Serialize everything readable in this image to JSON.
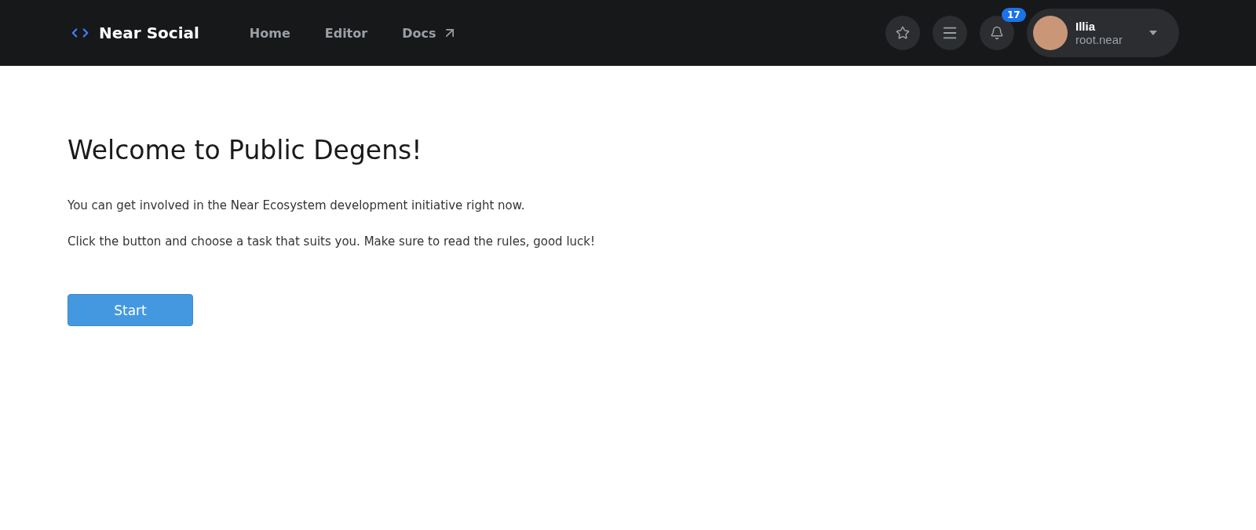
{
  "header": {
    "brand": "Near Social",
    "nav": [
      {
        "label": "Home",
        "kind": "internal"
      },
      {
        "label": "Editor",
        "kind": "internal"
      },
      {
        "label": "Docs",
        "kind": "external"
      }
    ],
    "notifications": {
      "count": "17"
    },
    "user": {
      "name": "Illia",
      "account": "root.near"
    }
  },
  "main": {
    "title": "Welcome to Public Degens!",
    "paragraphs": [
      "You can get involved in the Near Ecosystem development initiative right now.",
      "Click the button and choose a task that suits you. Make sure to read the rules, good luck!"
    ],
    "button": "Start"
  }
}
